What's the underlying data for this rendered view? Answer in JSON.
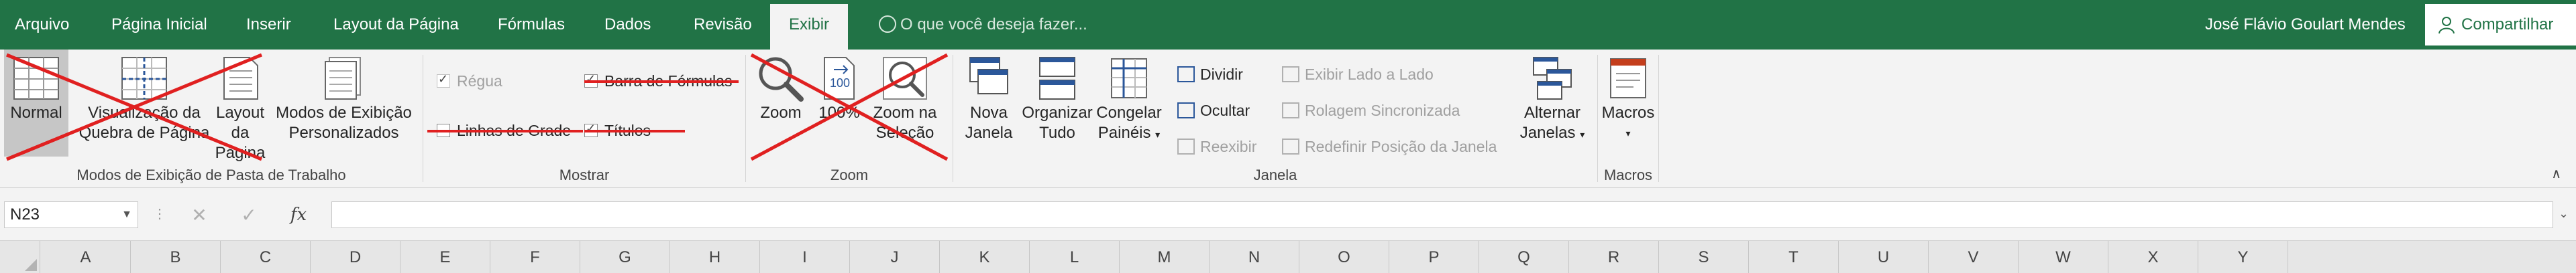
{
  "tabs": [
    "Arquivo",
    "Página Inicial",
    "Inserir",
    "Layout da Página",
    "Fórmulas",
    "Dados",
    "Revisão",
    "Exibir"
  ],
  "active_tab": "Exibir",
  "tell_me": "O que você deseja fazer...",
  "user_name": "José Flávio Goulart Mendes",
  "share_label": "Compartilhar",
  "groups": {
    "workbook_views": {
      "label": "Modos de Exibição de Pasta de Trabalho",
      "normal": "Normal",
      "page_break_1": "Visualização da",
      "page_break_2": "Quebra de Página",
      "page_layout_1": "Layout",
      "page_layout_2": "da Página",
      "custom_views_1": "Modos de Exibição",
      "custom_views_2": "Personalizados"
    },
    "show": {
      "label": "Mostrar",
      "ruler": "Régua",
      "formula_bar": "Barra de Fórmulas",
      "gridlines": "Linhas de Grade",
      "headings": "Títulos"
    },
    "zoom": {
      "label": "Zoom",
      "zoom": "Zoom",
      "hundred": "100%",
      "zoom_selection_1": "Zoom na",
      "zoom_selection_2": "Seleção"
    },
    "window": {
      "label": "Janela",
      "new_window_1": "Nova",
      "new_window_2": "Janela",
      "arrange_1": "Organizar",
      "arrange_2": "Tudo",
      "freeze_1": "Congelar",
      "freeze_2": "Painéis",
      "split": "Dividir",
      "hide": "Ocultar",
      "unhide": "Reexibir",
      "side_by_side": "Exibir Lado a Lado",
      "sync_scroll": "Rolagem Sincronizada",
      "reset_position": "Redefinir Posição da Janela",
      "switch_1": "Alternar",
      "switch_2": "Janelas"
    },
    "macros": {
      "label": "Macros",
      "macros": "Macros"
    }
  },
  "name_box": "N23",
  "formula_value": "",
  "columns": [
    "A",
    "B",
    "C",
    "D",
    "E",
    "F",
    "G",
    "H",
    "I",
    "J",
    "K",
    "L",
    "M",
    "N",
    "O",
    "P",
    "Q",
    "R",
    "S",
    "T",
    "U",
    "V",
    "W",
    "X",
    "Y"
  ],
  "colors": {
    "excel_green": "#217346",
    "annotation_red": "#e02020"
  }
}
